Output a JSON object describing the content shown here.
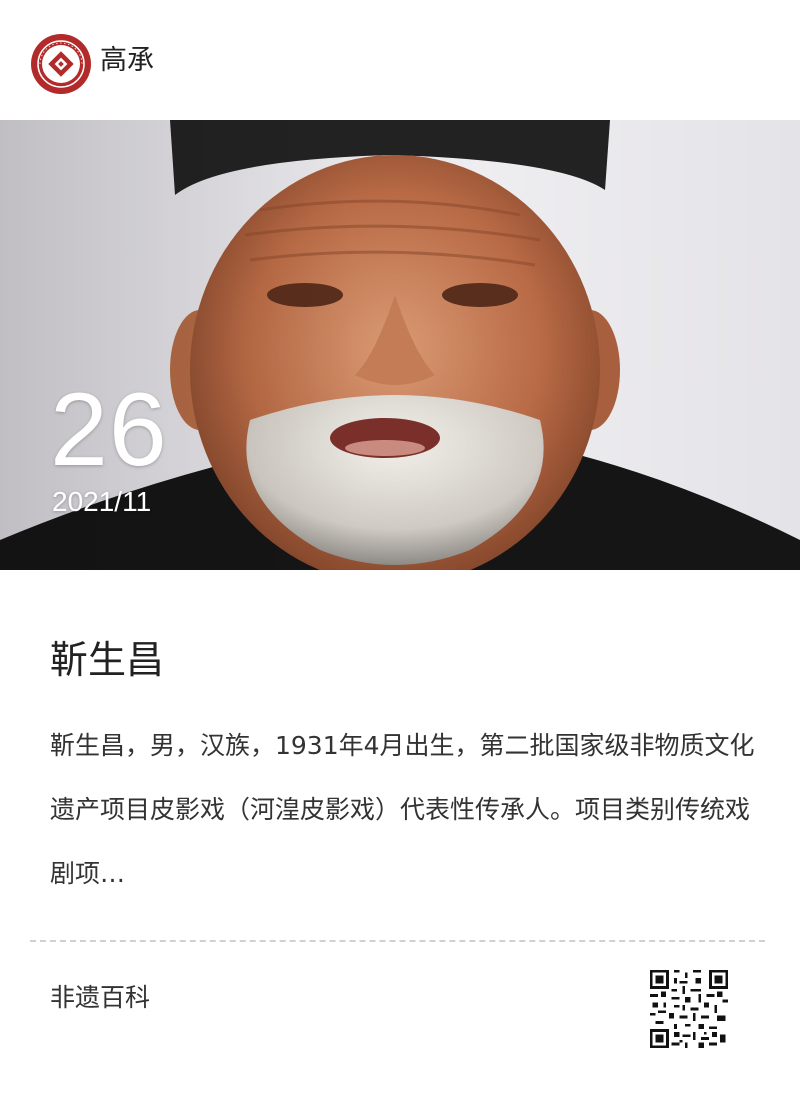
{
  "header": {
    "brand": "高承",
    "logo_icon": "heritage-seal-logo-icon",
    "logo_color": "#b32a2a"
  },
  "hero": {
    "photo": "portrait-photo",
    "day": "26",
    "year_month": "2021/11"
  },
  "article": {
    "title": "靳生昌",
    "summary": "靳生昌，男，汉族，1931年4月出生，第二批国家级非物质文化遗产项目皮影戏（河湟皮影戏）代表性传承人。项目类别传统戏剧项…"
  },
  "footer": {
    "label": "非遗百科",
    "qr_icon": "qr-code-icon"
  }
}
